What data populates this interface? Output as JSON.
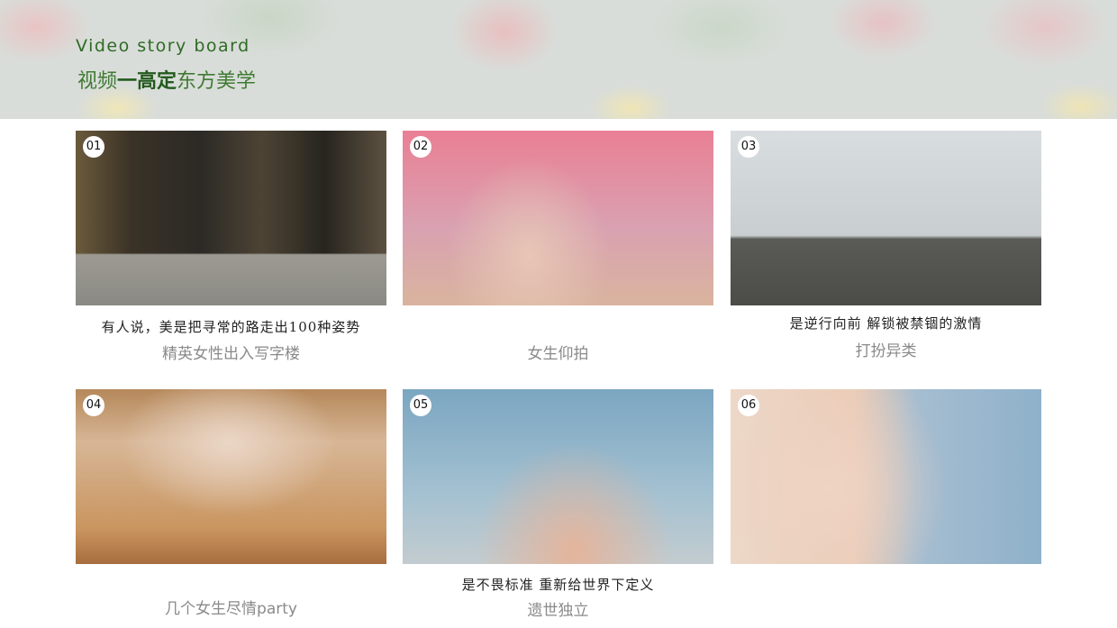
{
  "header": {
    "title_en": "Video story board",
    "title_cn_part1": "视频",
    "title_cn_dash": "一",
    "title_cn_part2": "高定",
    "title_cn_part3": "东方美学"
  },
  "frames": [
    {
      "number": "01",
      "caption": "有人说，美是把寻常的路走出100种姿势",
      "label": "精英女性出入写字楼"
    },
    {
      "number": "02",
      "caption": "",
      "label": "女生仰拍"
    },
    {
      "number": "03",
      "caption": "是逆行向前 解锁被禁锢的激情",
      "label": "打扮异类"
    },
    {
      "number": "04",
      "caption": "",
      "label": "几个女生尽情party"
    },
    {
      "number": "05",
      "caption": "是不畏标准  重新给世界下定义",
      "label": "遗世独立"
    },
    {
      "number": "06",
      "caption": "",
      "label": ""
    }
  ],
  "colors": {
    "header_text": "#2e6b25",
    "label_text": "#8a8a8a"
  }
}
